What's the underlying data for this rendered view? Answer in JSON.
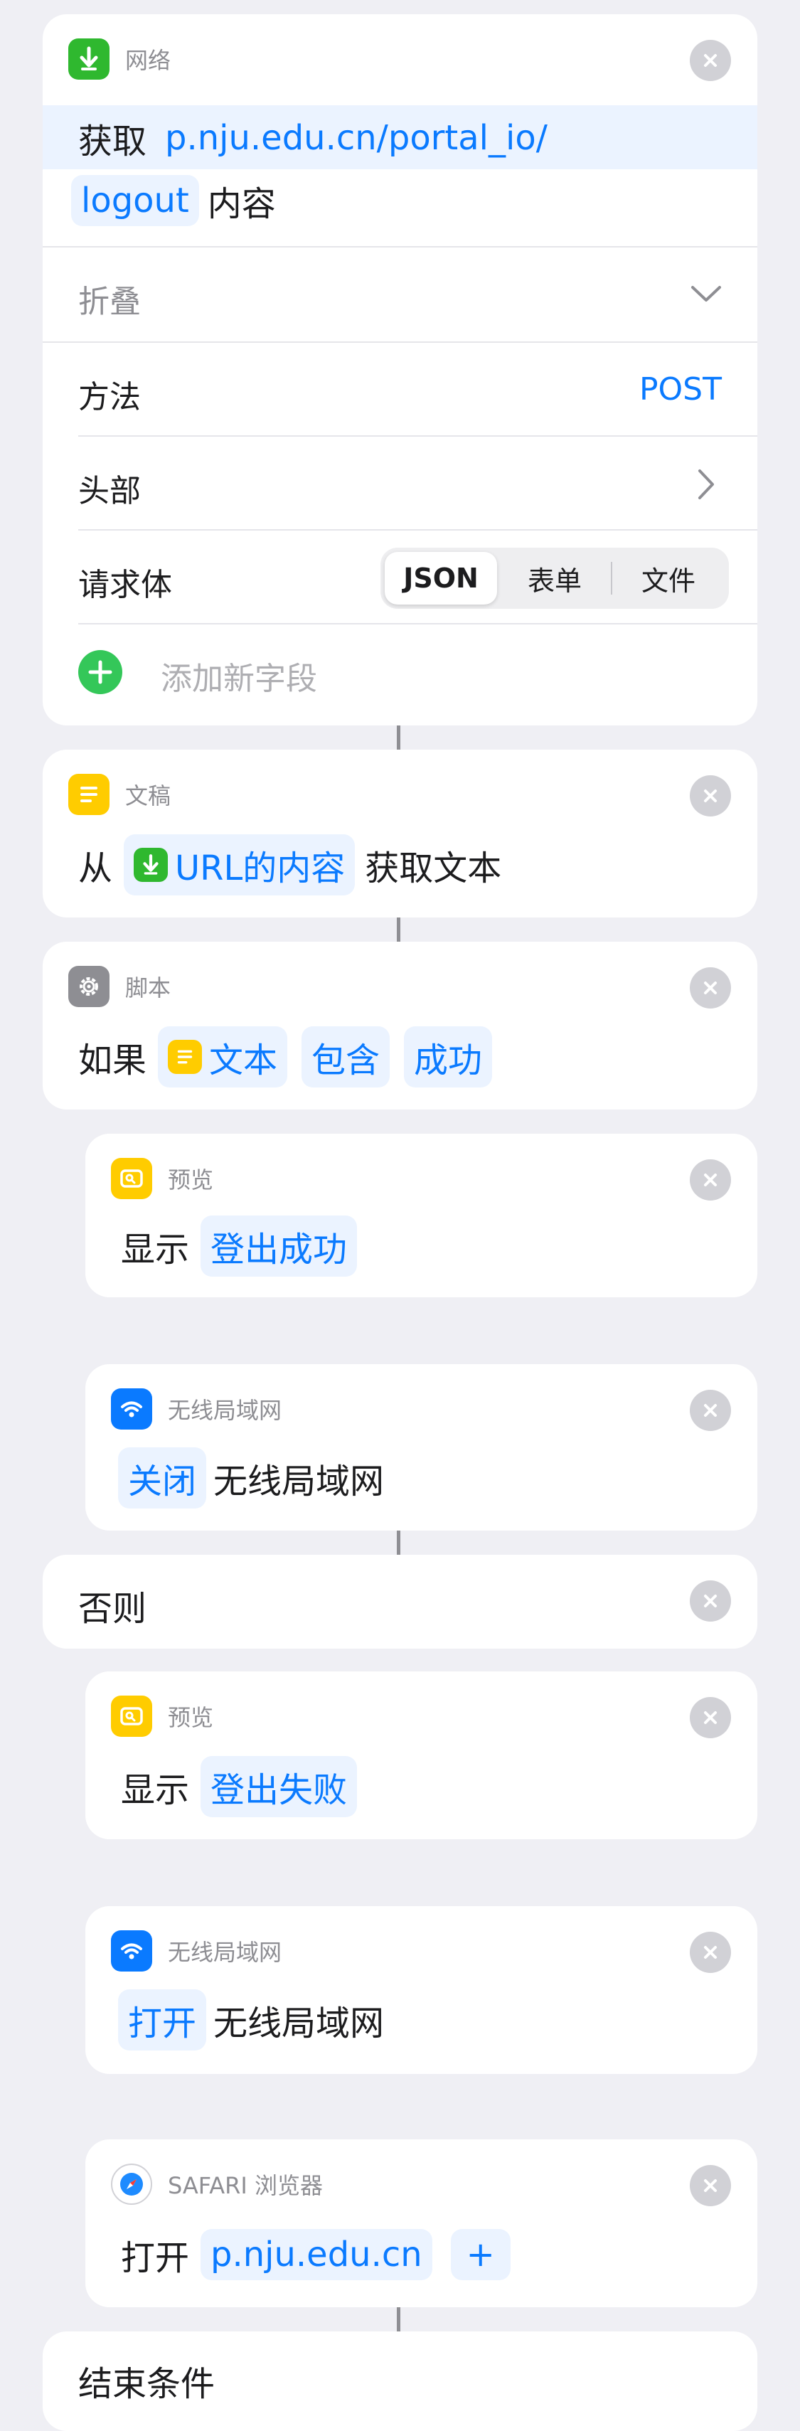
{
  "network_action": {
    "header": "网络",
    "prefix": "获取",
    "url_line1": "p.nju.edu.cn/portal_io/",
    "url_line2": "logout",
    "suffix": "内容",
    "collapse_label": "折叠",
    "method_label": "方法",
    "method_value": "POST",
    "headers_label": "头部",
    "body_label": "请求体",
    "body_options": [
      "JSON",
      "表单",
      "文件"
    ],
    "body_selected": "JSON",
    "add_field_label": "添加新字段"
  },
  "text_action": {
    "header": "文稿",
    "prefix": "从",
    "source": "URL的内容",
    "suffix": "获取文本"
  },
  "if_action": {
    "header": "脚本",
    "prefix": "如果",
    "input": "文本",
    "condition": "包含",
    "value": "成功"
  },
  "show_success": {
    "header": "预览",
    "verb": "显示",
    "value": "登出成功"
  },
  "wifi_off": {
    "header": "无线局域网",
    "state": "关闭",
    "target": "无线局域网"
  },
  "otherwise": {
    "label": "否则"
  },
  "show_fail": {
    "header": "预览",
    "verb": "显示",
    "value": "登出失败"
  },
  "wifi_on": {
    "header": "无线局域网",
    "state": "打开",
    "target": "无线局域网"
  },
  "safari_action": {
    "header": "SAFARI 浏览器",
    "verb": "打开",
    "url": "p.nju.edu.cn",
    "add": "+"
  },
  "end_if": {
    "label": "结束条件"
  },
  "colors": {
    "accent": "#0A7AFF",
    "network_green": "#2FB82F",
    "doc_yellow": "#FFCC00",
    "script_gray": "#8E8E93",
    "wifi_blue": "#0A7AFF",
    "add_green": "#34C759"
  }
}
